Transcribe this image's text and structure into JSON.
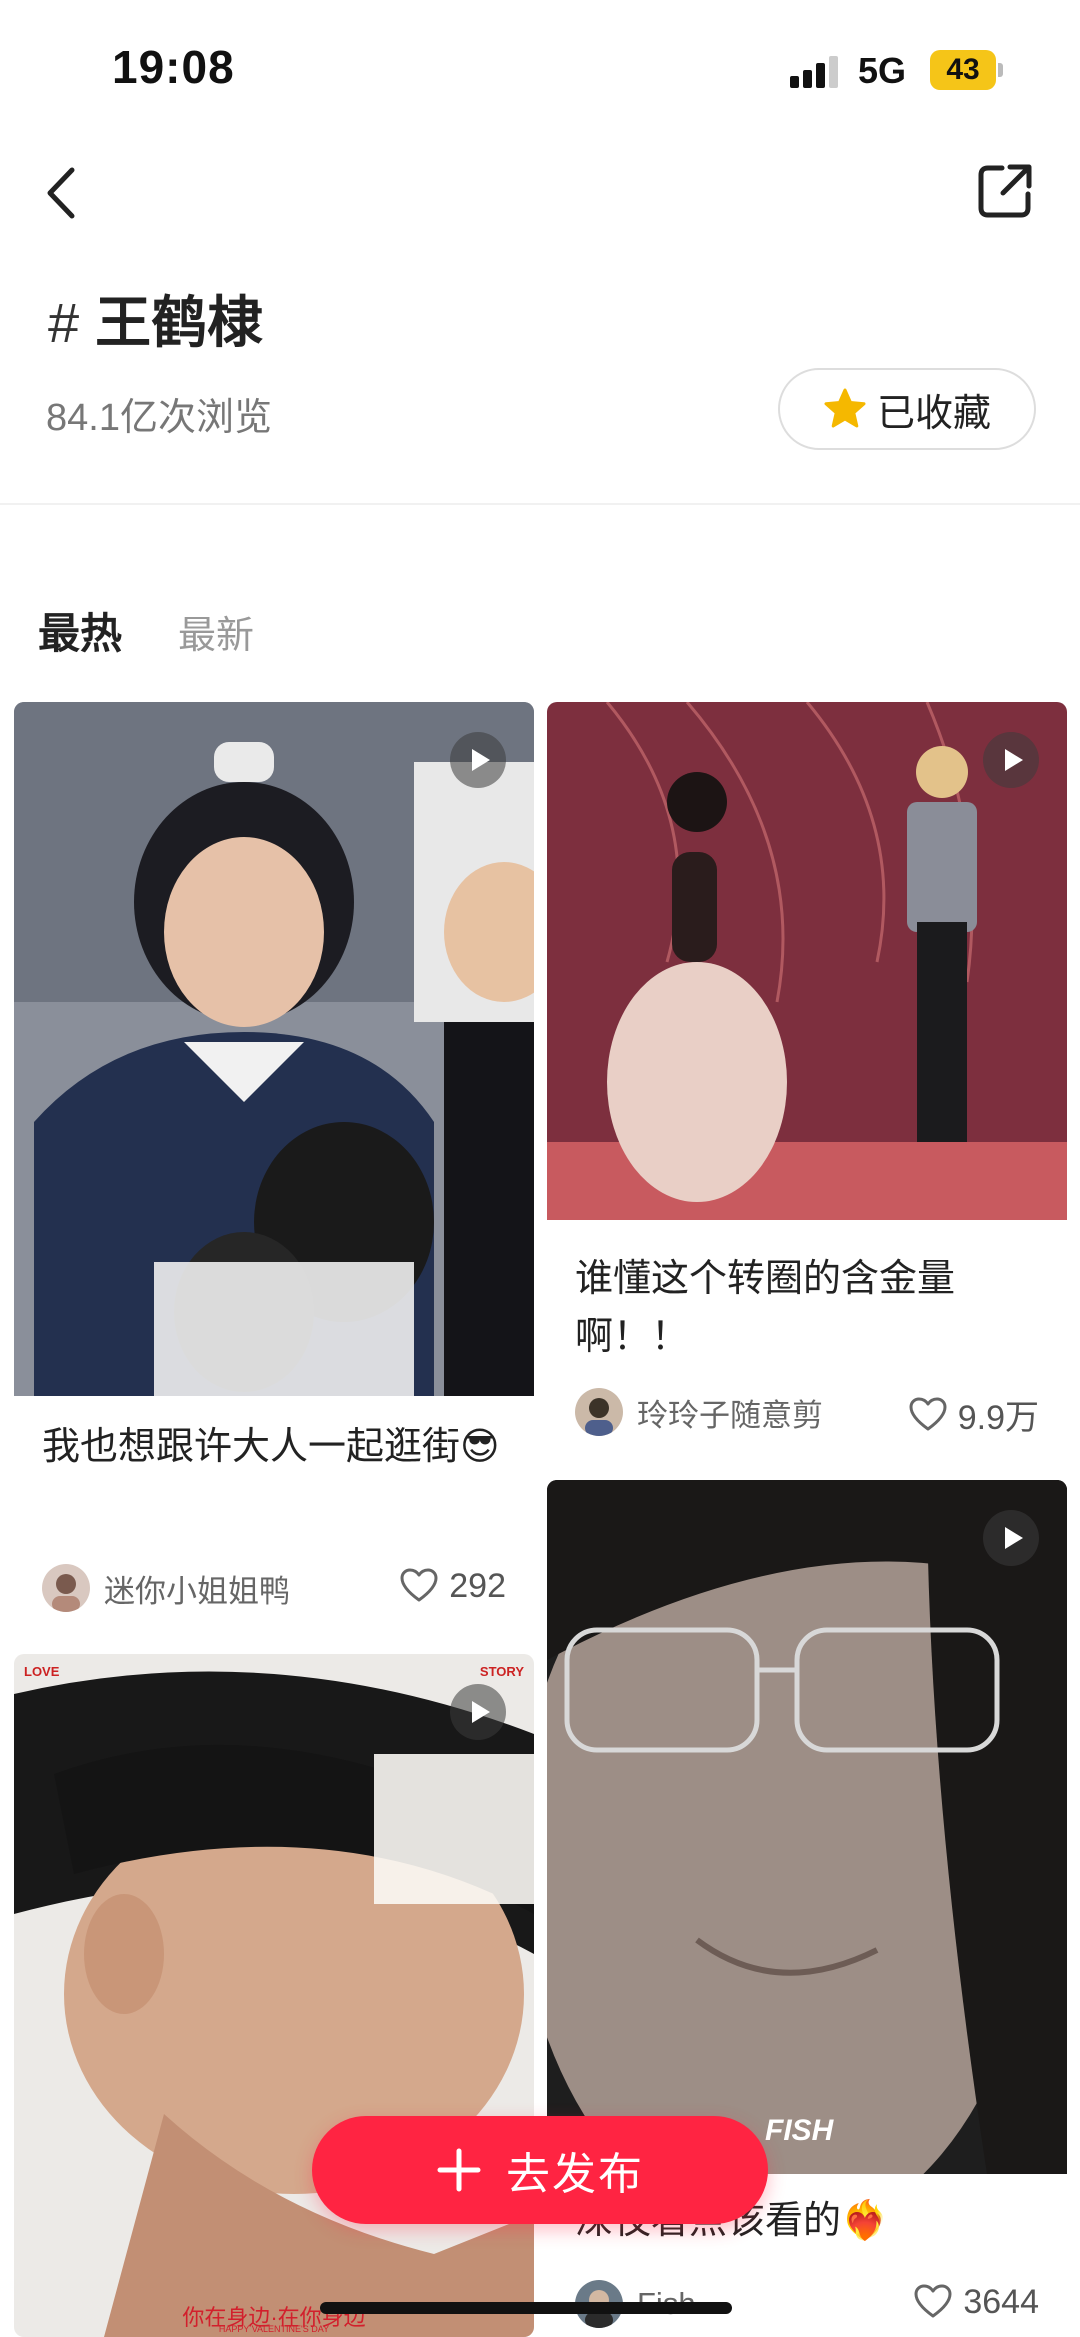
{
  "status_bar": {
    "time": "19:08",
    "network": "5G",
    "battery": "43"
  },
  "topic": {
    "title": "王鹤棣",
    "hash": "#",
    "views": "84.1亿次浏览",
    "favorite_label": "已收藏"
  },
  "tabs": [
    {
      "label": "最热"
    },
    {
      "label": "最新"
    }
  ],
  "posts": [
    {
      "title": "我也想跟许大人一起逛街😎",
      "author": "迷你小姐姐鸭",
      "likes": "292"
    },
    {
      "title": "谁懂这个转圈的含金量啊！！",
      "author": "玲玲子随意剪",
      "likes": "9.9万"
    },
    {
      "title": "",
      "author": "",
      "likes": "",
      "overlay_top_left": "LOVE",
      "overlay_top_right": "STORY",
      "overlay_bottom": "你在身边·在你身边",
      "overlay_bottom_small": "HAPPY VALENTINE'S DAY"
    },
    {
      "title": "深夜看点该看的❤️‍🔥",
      "author": "Fish",
      "likes": "3644",
      "overlay_text": "FISH"
    }
  ],
  "publish": {
    "label": "去发布"
  },
  "colors": {
    "accent": "#ff2442",
    "star": "#f5b800"
  }
}
